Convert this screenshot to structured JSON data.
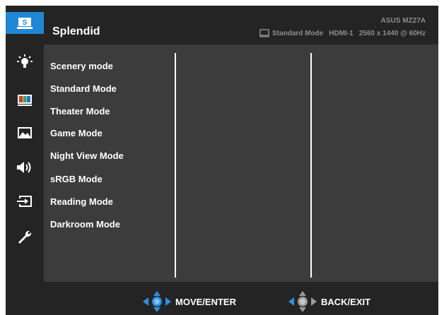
{
  "header": {
    "title": "Splendid",
    "model": "ASUS MZ27A",
    "mode": "Standard Mode",
    "input": "HDMI-1",
    "resolution": "2560 x 1440 @ 60Hz"
  },
  "sidebar": {
    "items": [
      {
        "icon": "splendid-icon",
        "label": "S",
        "active": true
      },
      {
        "icon": "brightness-icon",
        "active": false
      },
      {
        "icon": "color-icon",
        "active": false
      },
      {
        "icon": "image-icon",
        "active": false
      },
      {
        "icon": "sound-icon",
        "active": false
      },
      {
        "icon": "input-select-icon",
        "active": false
      },
      {
        "icon": "system-setup-icon",
        "active": false
      }
    ]
  },
  "menu": {
    "items": [
      "Scenery mode",
      "Standard Mode",
      "Theater Mode",
      "Game Mode",
      "Night View Mode",
      "sRGB Mode",
      "Reading Mode",
      "Darkroom Mode"
    ]
  },
  "footer": {
    "move_label": "MOVE/ENTER",
    "back_label": "BACK/EXIT"
  },
  "colors": {
    "accent": "#1f87d6",
    "panel": "#3c3c3c",
    "bar": "#242424"
  }
}
